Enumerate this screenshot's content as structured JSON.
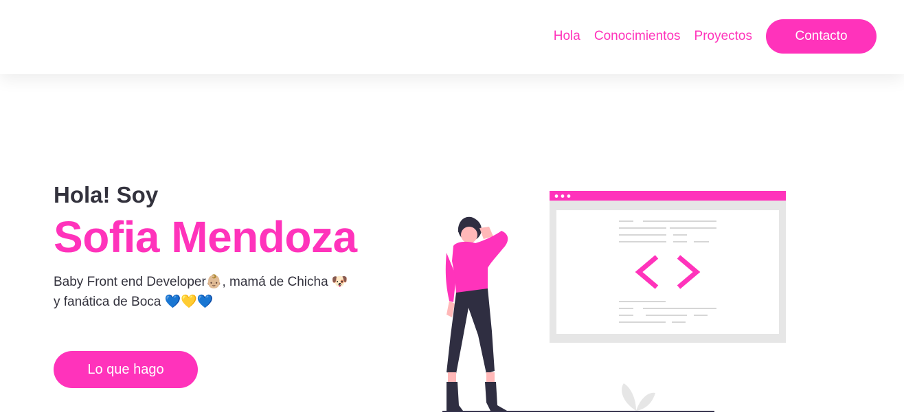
{
  "nav": {
    "links": [
      {
        "label": "Hola"
      },
      {
        "label": "Conocimientos"
      },
      {
        "label": "Proyectos"
      }
    ],
    "contact_label": "Contacto"
  },
  "hero": {
    "greeting": "Hola! Soy",
    "name": "Sofia Mendoza",
    "description_line1": "Baby Front end Developer👶🏼, mamá de Chicha 🐶",
    "description_line2": "y fanática de Boca 💙💛💙",
    "cta_label": "Lo que hago"
  },
  "colors": {
    "accent": "#ff33bb",
    "text": "#33323d",
    "illustration_dark": "#2f2e41",
    "illustration_gray": "#e6e6e6"
  },
  "icons": [
    "code-brackets-icon",
    "leaf-icon",
    "browser-dots-icon"
  ]
}
